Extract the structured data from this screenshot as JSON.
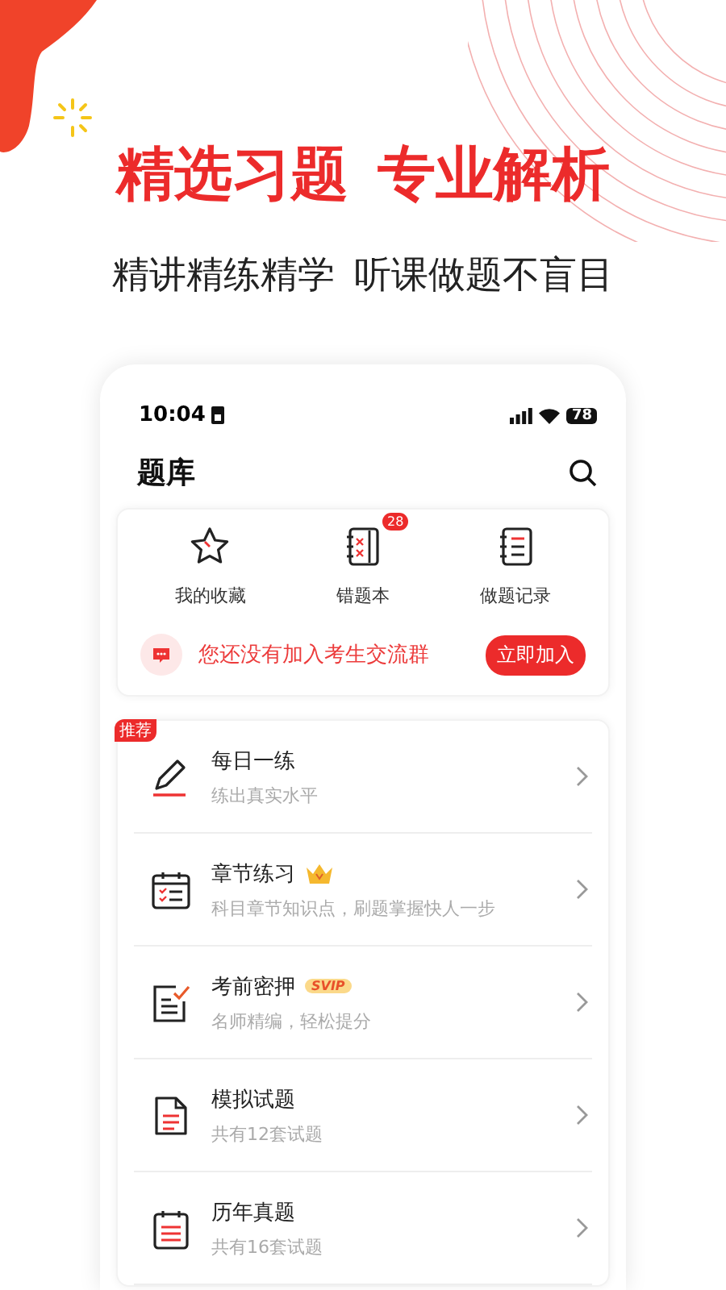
{
  "headline": [
    "精选习题",
    "专业解析"
  ],
  "subtitle": [
    "精讲精练精学",
    "听课做题不盲目"
  ],
  "phone": {
    "time": "10:04",
    "battery": "78",
    "title": "题库",
    "shortcuts": [
      {
        "label": "我的收藏",
        "kind": "star"
      },
      {
        "label": "错题本",
        "kind": "notebook",
        "badge": "28"
      },
      {
        "label": "做题记录",
        "kind": "record"
      }
    ],
    "banner": {
      "text": "您还没有加入考生交流群",
      "button": "立即加入"
    },
    "items": [
      {
        "title": "每日一练",
        "subtitle": "练出真实水平",
        "kind": "pencil",
        "ribbon": "推荐"
      },
      {
        "title": "章节练习",
        "subtitle": "科目章节知识点，刷题掌握快人一步",
        "kind": "calendar",
        "tag": {
          "kind": "crown"
        }
      },
      {
        "title": "考前密押",
        "subtitle": "名师精编，轻松提分",
        "kind": "checklist",
        "tag": {
          "kind": "svip",
          "text": "SVIP"
        }
      },
      {
        "title": "模拟试题",
        "subtitle": "共有12套试题",
        "kind": "document"
      },
      {
        "title": "历年真题",
        "subtitle": "共有16套试题",
        "kind": "planner"
      }
    ]
  }
}
